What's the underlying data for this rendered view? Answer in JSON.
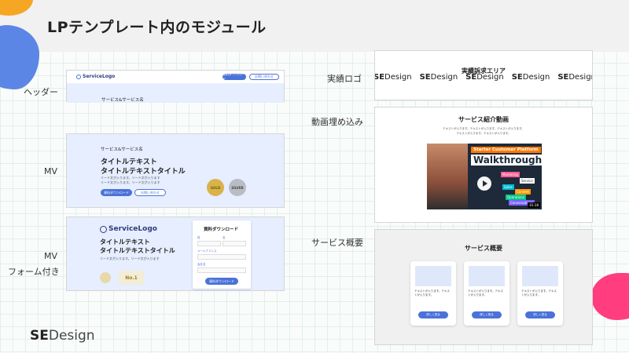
{
  "page": {
    "title": "LPテンプレート内のモジュール"
  },
  "labels": {
    "header": "ヘッダー",
    "mv": "MV",
    "mv_form_1": "MV",
    "mv_form_2": "フォーム付き",
    "achievement": "実績ロゴ",
    "video": "動画埋め込み",
    "service": "サービス概要"
  },
  "header_module": {
    "logo": "ServiceLogo",
    "btn_primary": "資料ダウンロード",
    "btn_secondary": "お問い合わせ",
    "band_text": "サービス&サービス名"
  },
  "mv_module": {
    "eyebrow": "サービス&サービス名",
    "heading_1": "タイトルテキスト",
    "heading_2": "タイトルテキストタイトル",
    "body_1": "リード文が入ります。リード文が入ります",
    "body_2": "リード文が入ります。リード文が入ります",
    "btn_primary": "資料ダウンロード",
    "btn_secondary": "お問い合わせ",
    "medal_gold": "GOLD",
    "medal_silver": "SILVER"
  },
  "mv_form_module": {
    "logo": "ServiceLogo",
    "heading_1": "タイトルテキスト",
    "heading_2": "タイトルテキストタイトル",
    "body": "リード文が入ります。リード文が入ります",
    "badge": "No.1",
    "form_title": "資料ダウンロード",
    "field_name_1": "姓",
    "field_name_2": "名",
    "field_email": "メールアドレス",
    "field_company": "会社名",
    "submit": "資料ダウンロード"
  },
  "achievement_module": {
    "title": "実績訴求エリア",
    "logo_text_bold": "SE",
    "logo_text": "Design"
  },
  "video_module": {
    "title": "サービス紹介動画",
    "caption_1": "テキストが入ります。テキストが入ります。テキストが入ります。",
    "caption_2": "テキストが入ります。テキストが入ります。",
    "video_title_small": "Starter Customer Platform",
    "video_title": "Walkthrough",
    "tag_1": "Marketing",
    "tag_2": "Service",
    "tag_3": "Sales",
    "tag_4": "Content",
    "tag_5": "Operations",
    "tag_6": "Conversations",
    "duration": "01:38"
  },
  "service_module": {
    "title": "サービス概要",
    "card_text_1": "テキストが入ります。テキストが入ります。",
    "card_text_2": "テキストが入ります。テキストが入ります。",
    "card_text_3": "テキストが入ります。テキストが入ります。",
    "card_btn": "詳しく見る"
  },
  "brand": {
    "bold": "SE",
    "rest": "Design"
  },
  "colors": {
    "accent": "#4a72d8",
    "light_blue": "#e6eeff",
    "blob_blue": "#5b86e5",
    "blob_orange": "#f5a623",
    "blob_pink": "#ff3d7f"
  }
}
